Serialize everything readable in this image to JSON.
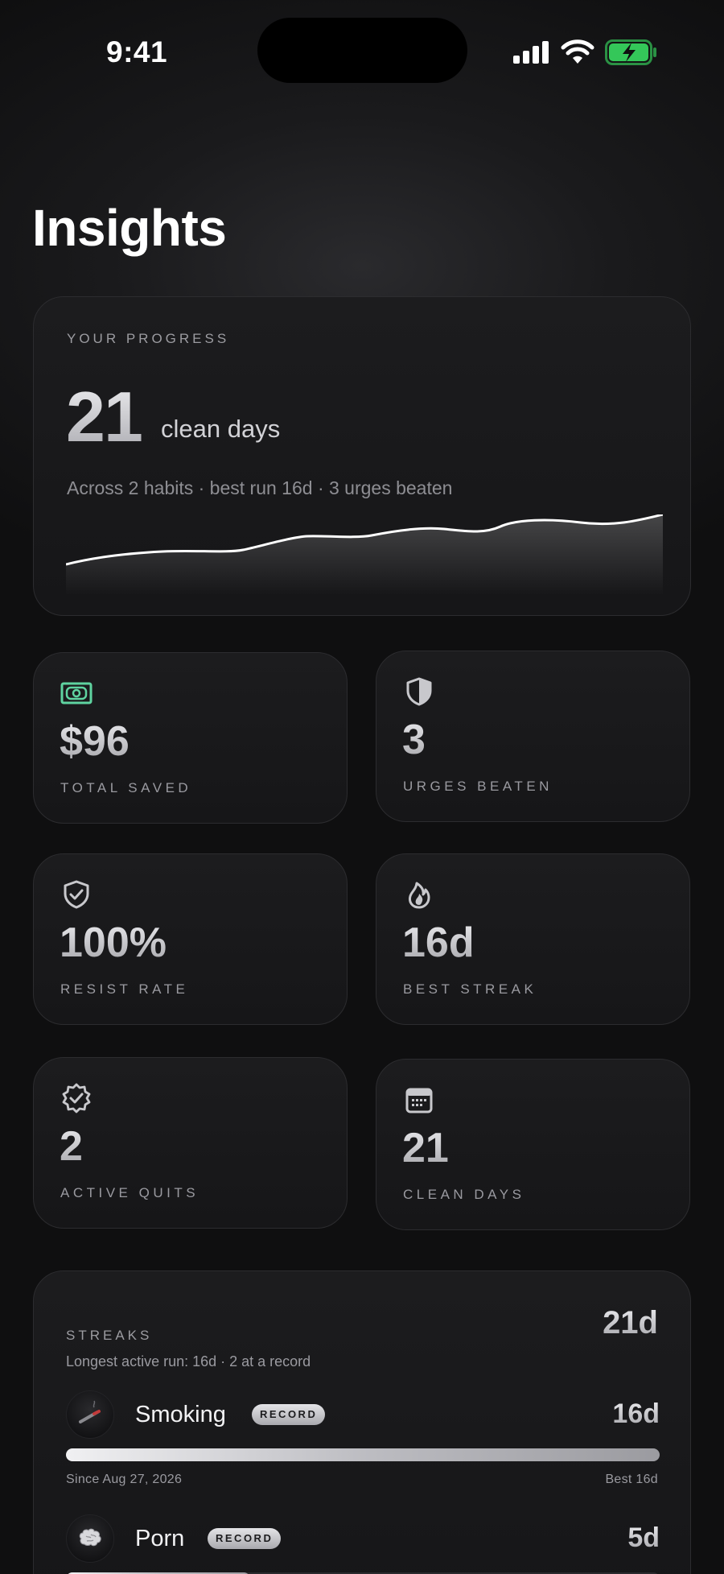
{
  "status_bar": {
    "time": "9:41"
  },
  "page": {
    "title": "Insights"
  },
  "progress": {
    "eyebrow": "YOUR PROGRESS",
    "clean_days": "21",
    "unit": "clean days",
    "summary": "Across 2 habits · best run 16d · 3 urges beaten"
  },
  "stats": [
    {
      "icon": "money-icon",
      "value": "$96",
      "label": "TOTAL SAVED"
    },
    {
      "icon": "shield-icon",
      "value": "3",
      "label": "URGES BEATEN"
    },
    {
      "icon": "shield-check-icon",
      "value": "100%",
      "label": "RESIST RATE"
    },
    {
      "icon": "flame-icon",
      "value": "16d",
      "label": "BEST STREAK"
    },
    {
      "icon": "badge-check-icon",
      "value": "2",
      "label": "ACTIVE QUITS"
    },
    {
      "icon": "calendar-icon",
      "value": "21",
      "label": "CLEAN DAYS"
    }
  ],
  "streaks": {
    "eyebrow": "STREAKS",
    "subtitle": "Longest active run: 16d · 2 at a record",
    "total": "21d",
    "habits": [
      {
        "name": "Smoking",
        "badge": "RECORD",
        "streak": "16d",
        "since": "Since Aug 27, 2026",
        "best": "Best 16d",
        "progress": 1.0,
        "icon": "cigarette-icon"
      },
      {
        "name": "Porn",
        "badge": "RECORD",
        "streak": "5d",
        "progress": 0.31,
        "icon": "brain-icon"
      }
    ]
  },
  "colors": {
    "accent_green": "#34c759",
    "money_green": "#5fd3a0"
  }
}
